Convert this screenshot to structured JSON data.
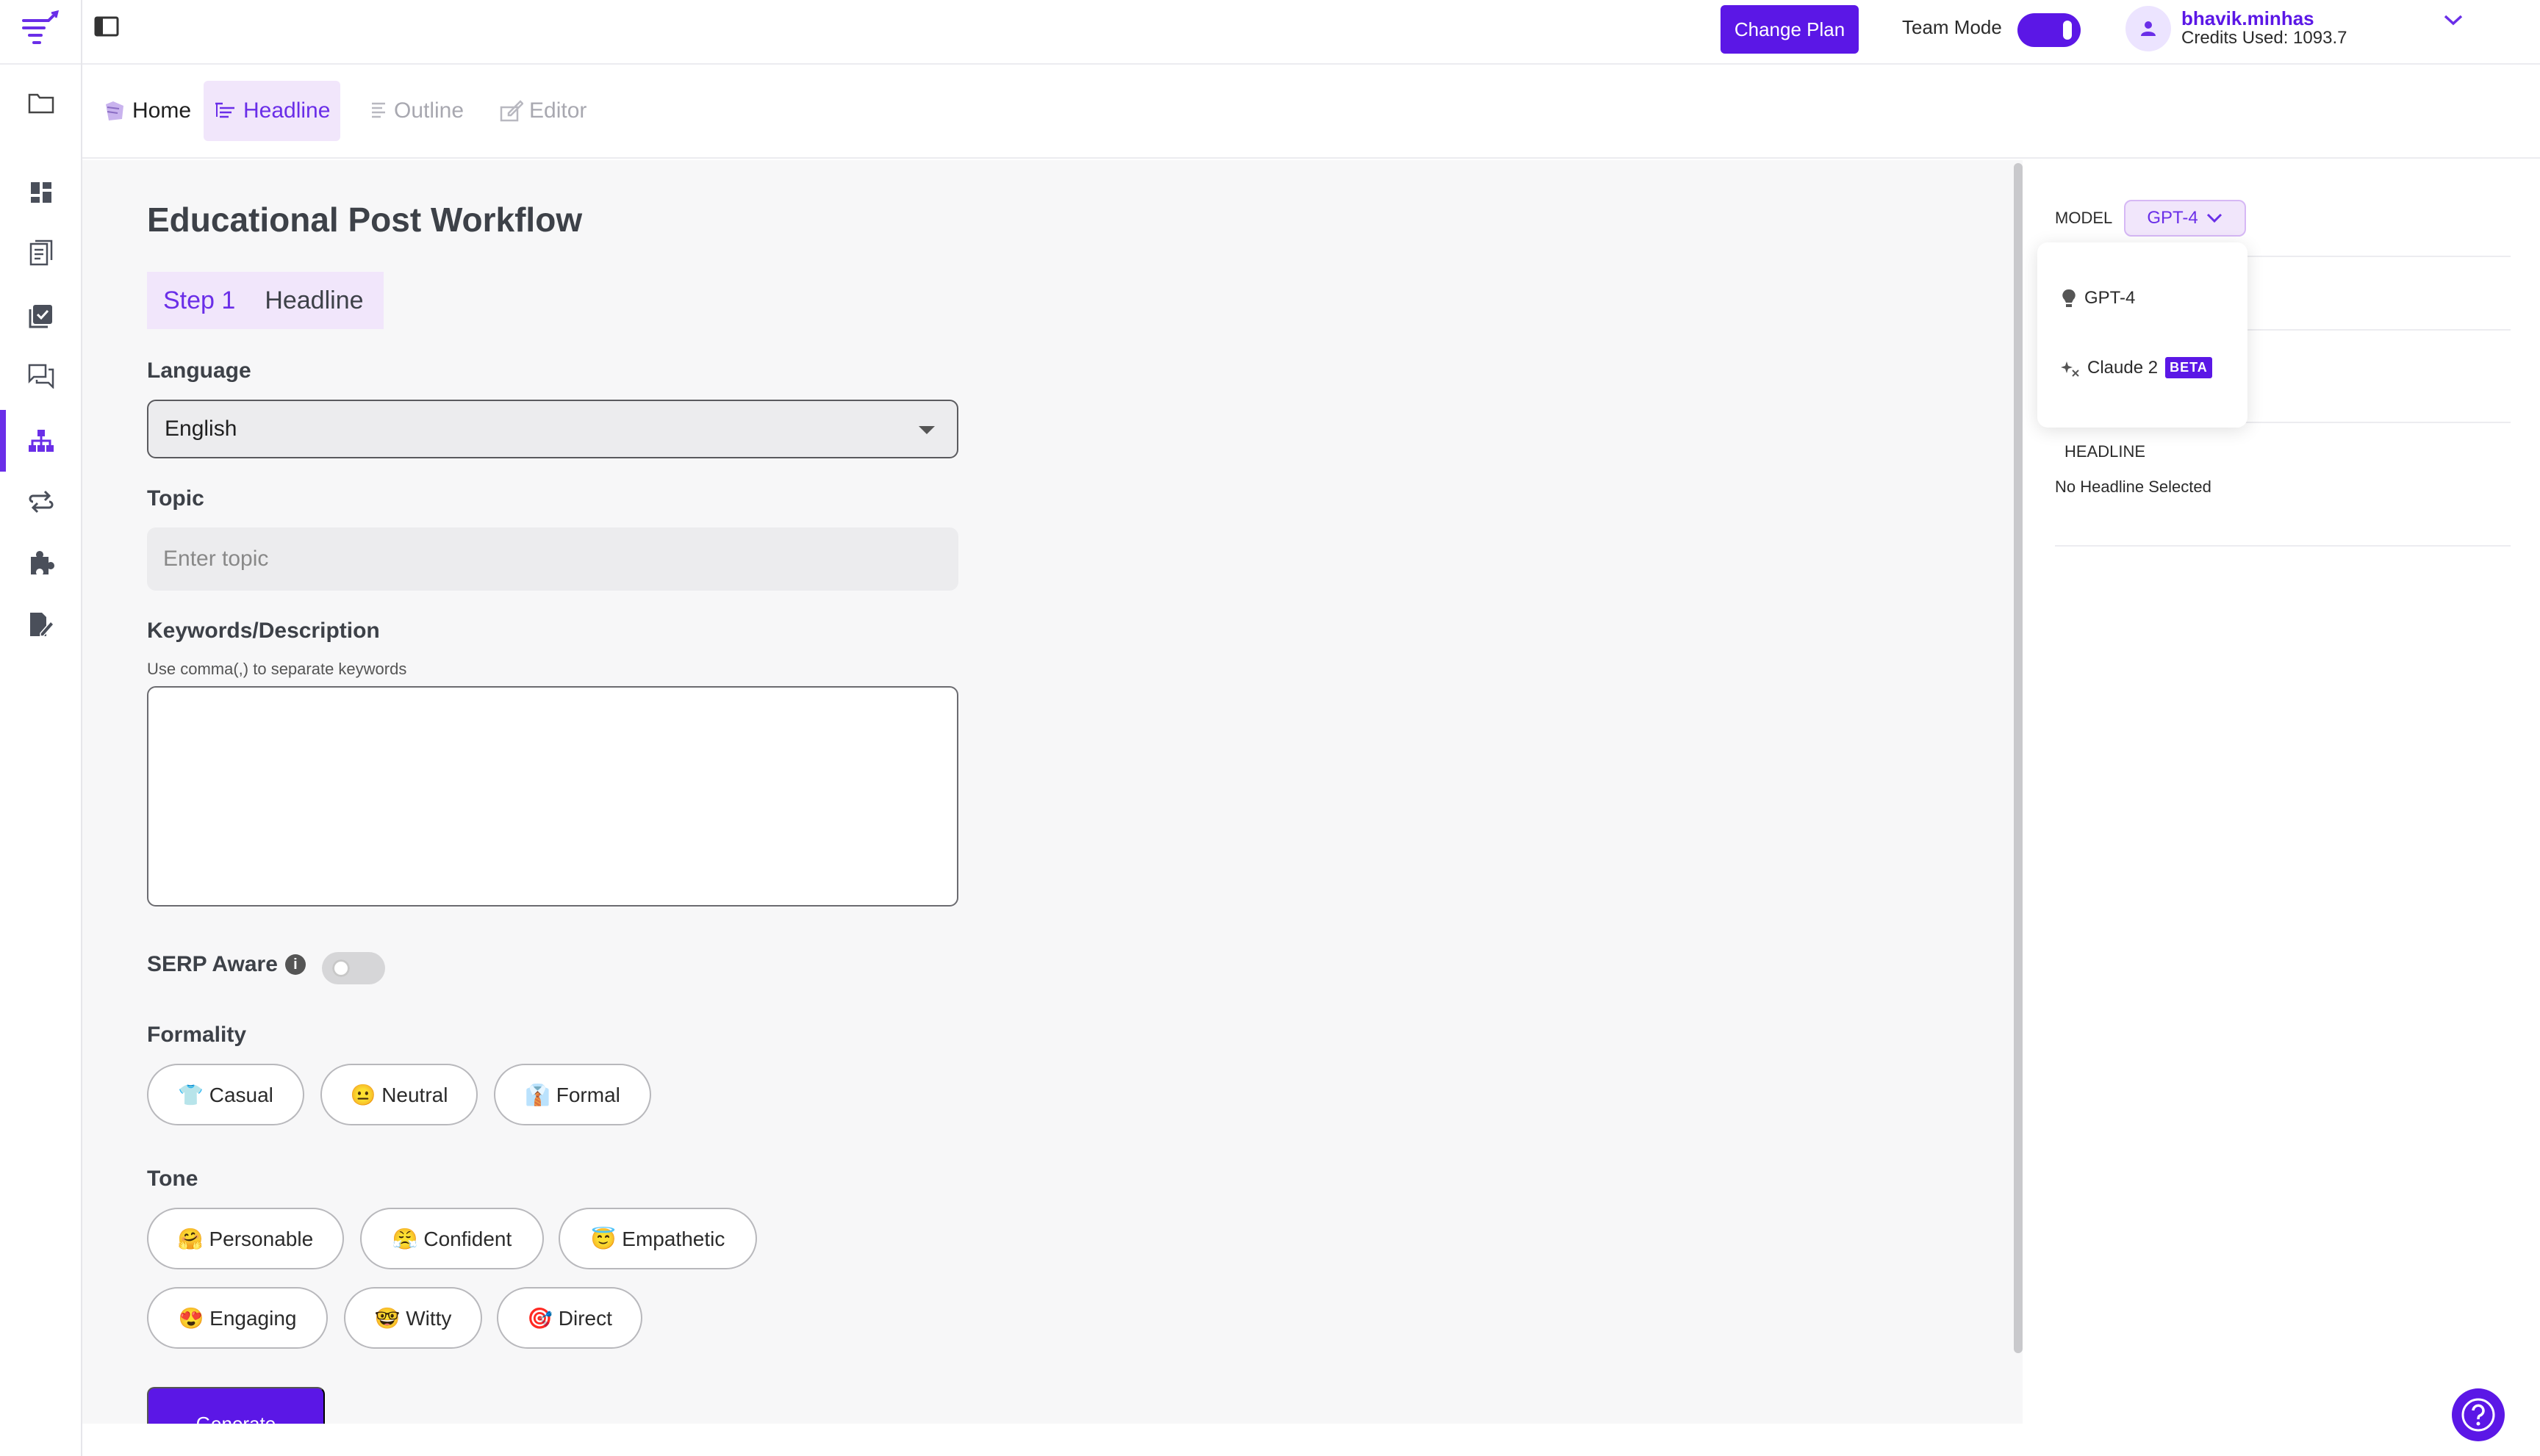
{
  "topbar": {
    "change_plan": "Change Plan",
    "team_mode_label": "Team Mode",
    "team_mode_on": true,
    "user_name": "bhavik.minhas",
    "credits": "Credits Used: 1093.7"
  },
  "nav": {
    "tabs": [
      {
        "label": "Home",
        "icon": "home-icon"
      },
      {
        "label": "Headline",
        "icon": "headline-icon"
      },
      {
        "label": "Outline",
        "icon": "outline-icon"
      },
      {
        "label": "Editor",
        "icon": "editor-icon"
      }
    ],
    "active_tab": "Headline"
  },
  "form": {
    "title": "Educational Post Workflow",
    "step_label": "Step 1",
    "step_name": "Headline",
    "language_label": "Language",
    "language_value": "English",
    "topic_label": "Topic",
    "topic_placeholder": "Enter topic",
    "keywords_label": "Keywords/Description",
    "keywords_hint": "Use comma(,) to separate keywords",
    "serp_label": "SERP Aware",
    "serp_on": false,
    "formality_label": "Formality",
    "formality_options": [
      "👕 Casual",
      "😐 Neutral",
      "👔 Formal"
    ],
    "tone_label": "Tone",
    "tone_options": [
      "🤗 Personable",
      "😤 Confident",
      "😇 Empathetic",
      "😍 Engaging",
      "🤓 Witty",
      "🎯 Direct"
    ],
    "generate": "Generate"
  },
  "sidebar": {
    "model_label": "MODEL",
    "model_selected": "GPT-4",
    "model_options": [
      {
        "label": "GPT-4",
        "icon": "bulb-icon"
      },
      {
        "label": "Claude 2",
        "icon": "sparkle-icon",
        "badge": "BETA"
      }
    ],
    "headline_label": "HEADLINE",
    "headline_value": "No Headline Selected"
  },
  "colors": {
    "accent": "#5b17e6",
    "accent_soft": "#f1e6fb"
  }
}
